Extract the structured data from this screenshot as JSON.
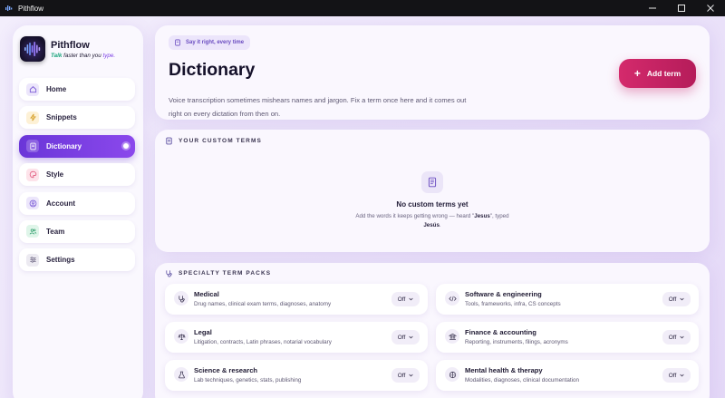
{
  "window": {
    "title": "Pithflow",
    "controls": [
      "minimize",
      "maximize",
      "close"
    ]
  },
  "brand": {
    "name": "Pithflow",
    "tagline_part1": "Talk",
    "tagline_part2": " faster than you ",
    "tagline_part3": "type."
  },
  "sidebar": {
    "items": [
      {
        "label": "Home",
        "icon": "home-icon",
        "color": "#ece6fb",
        "active": false
      },
      {
        "label": "Snippets",
        "icon": "bolt-icon",
        "color": "#fdf1d6",
        "active": false
      },
      {
        "label": "Dictionary",
        "icon": "book-icon",
        "color": "#ece6fb",
        "active": true
      },
      {
        "label": "Style",
        "icon": "palette-icon",
        "color": "#fde3ea",
        "active": false
      },
      {
        "label": "Account",
        "icon": "user-circle-icon",
        "color": "#ece6fb",
        "active": false
      },
      {
        "label": "Team",
        "icon": "users-icon",
        "color": "#dff5e9",
        "active": false
      },
      {
        "label": "Settings",
        "icon": "sliders-icon",
        "color": "#eceaf1",
        "active": false
      }
    ]
  },
  "hero": {
    "pill": "Say it right, every time",
    "title": "Dictionary",
    "description": "Voice transcription sometimes mishears names and jargon. Fix a term once here and it comes out right on every dictation from then on.",
    "add_button": "Add term"
  },
  "custom_terms": {
    "heading": "YOUR CUSTOM TERMS",
    "empty_title": "No custom terms yet",
    "empty_desc_prefix": "Add the words it keeps getting wrong — heard \"",
    "empty_desc_heard": "Jesus",
    "empty_desc_mid": "\", typed",
    "empty_desc_typed": "Jesús",
    "empty_desc_suffix": "."
  },
  "packs": {
    "heading": "SPECIALTY TERM PACKS",
    "items": [
      {
        "name": "Medical",
        "desc": "Drug names, clinical exam terms, diagnoses, anatomy",
        "state": "Off",
        "icon": "stethoscope-icon"
      },
      {
        "name": "Software & engineering",
        "desc": "Tools, frameworks, infra, CS concepts",
        "state": "Off",
        "icon": "code-icon"
      },
      {
        "name": "Legal",
        "desc": "Litigation, contracts, Latin phrases, notarial vocabulary",
        "state": "Off",
        "icon": "scales-icon"
      },
      {
        "name": "Finance & accounting",
        "desc": "Reporting, instruments, filings, acronyms",
        "state": "Off",
        "icon": "bank-icon"
      },
      {
        "name": "Science & research",
        "desc": "Lab techniques, genetics, stats, publishing",
        "state": "Off",
        "icon": "flask-icon"
      },
      {
        "name": "Mental health & therapy",
        "desc": "Modalities, diagnoses, clinical documentation",
        "state": "Off",
        "icon": "brain-icon"
      }
    ]
  },
  "colors": {
    "accent": "#7b3fe4",
    "add_button": "#c8246a",
    "background": "#ede6fa"
  }
}
